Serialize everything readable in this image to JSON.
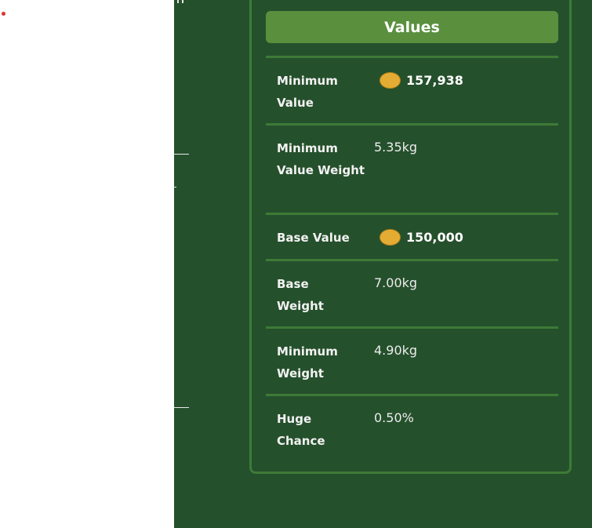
{
  "panel": {
    "header_label": "Values",
    "rows": [
      {
        "label": "Minimum Value",
        "value": "157,938",
        "icon": "coin-icon"
      },
      {
        "label": "Minimum Value Weight",
        "value": "5.35kg"
      },
      {
        "label": "Base Value",
        "value": "150,000",
        "icon": "coin-icon"
      },
      {
        "label": "Base Weight",
        "value": "7.00kg"
      },
      {
        "label": "Minimum Weight",
        "value": "4.90kg"
      },
      {
        "label": "Huge Chance",
        "value": "0.50%"
      }
    ]
  },
  "colors": {
    "background": "#25502c",
    "panel_border": "#3d7a37",
    "header": "#5a8f3e",
    "coin": "#e5ac34"
  }
}
